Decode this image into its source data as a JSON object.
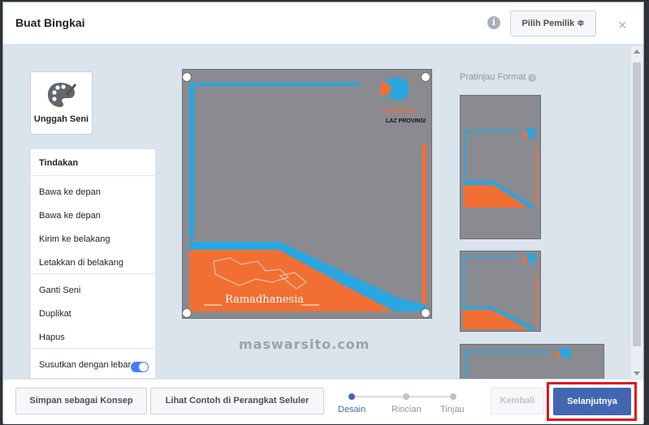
{
  "header": {
    "title": "Buat Bingkai",
    "owner_button": "Pilih Pemilik ≑",
    "close_symbol": "×",
    "info_symbol": "i"
  },
  "sidebar": {
    "upload_label": "Unggah Seni",
    "actions_title": "Tindakan",
    "actions_group1": [
      "Bawa ke depan",
      "Bawa ke depan",
      "Kirim ke belakang",
      "Letakkan di belakang"
    ],
    "actions_group2": [
      "Ganti Seni",
      "Duplikat",
      "Hapus"
    ],
    "shrink_toggle_label": "Susutkan dengan lebar",
    "shrink_toggle_on": true
  },
  "frame": {
    "logo_text": "solopeduli",
    "logo_sub": "LAZ PROVINSI",
    "banner_text": "Ramadhanesia",
    "colors": {
      "photo": "#8a8b91",
      "orange": "#f26f33",
      "blue": "#2aa6e0"
    }
  },
  "preview": {
    "label": "Pratinjau Format"
  },
  "watermark": "maswarsito.com",
  "footer": {
    "save_draft": "Simpan sebagai Konsep",
    "view_mobile": "Lihat Contoh di Perangkat Seluler",
    "steps": [
      "Desain",
      "Rincian",
      "Tinjau"
    ],
    "active_step": 0,
    "back": "Kembali",
    "next": "Selanjutnya"
  }
}
